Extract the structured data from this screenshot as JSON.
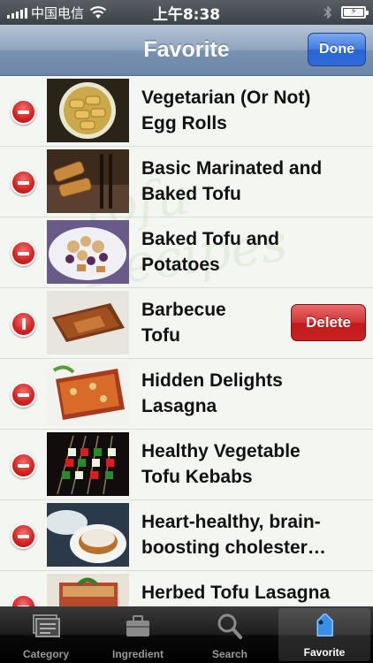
{
  "status_bar": {
    "carrier": "中国电信",
    "time": "上午8:38"
  },
  "nav": {
    "title": "Favorite",
    "done_label": "Done"
  },
  "watermark": "Tofu Recipes",
  "items": [
    {
      "title": "Vegetarian (Or Not)\nEgg Rolls",
      "thumb": "egg-rolls-dish"
    },
    {
      "title": "Basic Marinated and\nBaked Tofu",
      "thumb": "baked-tofu"
    },
    {
      "title": "Baked Tofu and\nPotatoes",
      "thumb": "tofu-potatoes"
    },
    {
      "title": "Barbecue\nTofu",
      "thumb": "barbecue-tofu",
      "delete_label": "Delete"
    },
    {
      "title": "Hidden Delights\nLasagna",
      "thumb": "lasagna"
    },
    {
      "title": "Healthy Vegetable\nTofu Kebabs",
      "thumb": "kebabs"
    },
    {
      "title": "Heart-healthy, brain-\nboosting cholester…",
      "thumb": "cheesecake"
    },
    {
      "title": "Herbed Tofu Lasagna\nWith Fresh Herbs",
      "thumb": "herbed-lasagna"
    }
  ],
  "tabs": [
    {
      "label": "Category",
      "icon": "category-icon"
    },
    {
      "label": "Ingredient",
      "icon": "briefcase-icon"
    },
    {
      "label": "Search",
      "icon": "search-icon"
    },
    {
      "label": "Favorite",
      "icon": "tag-icon",
      "active": true
    }
  ]
}
